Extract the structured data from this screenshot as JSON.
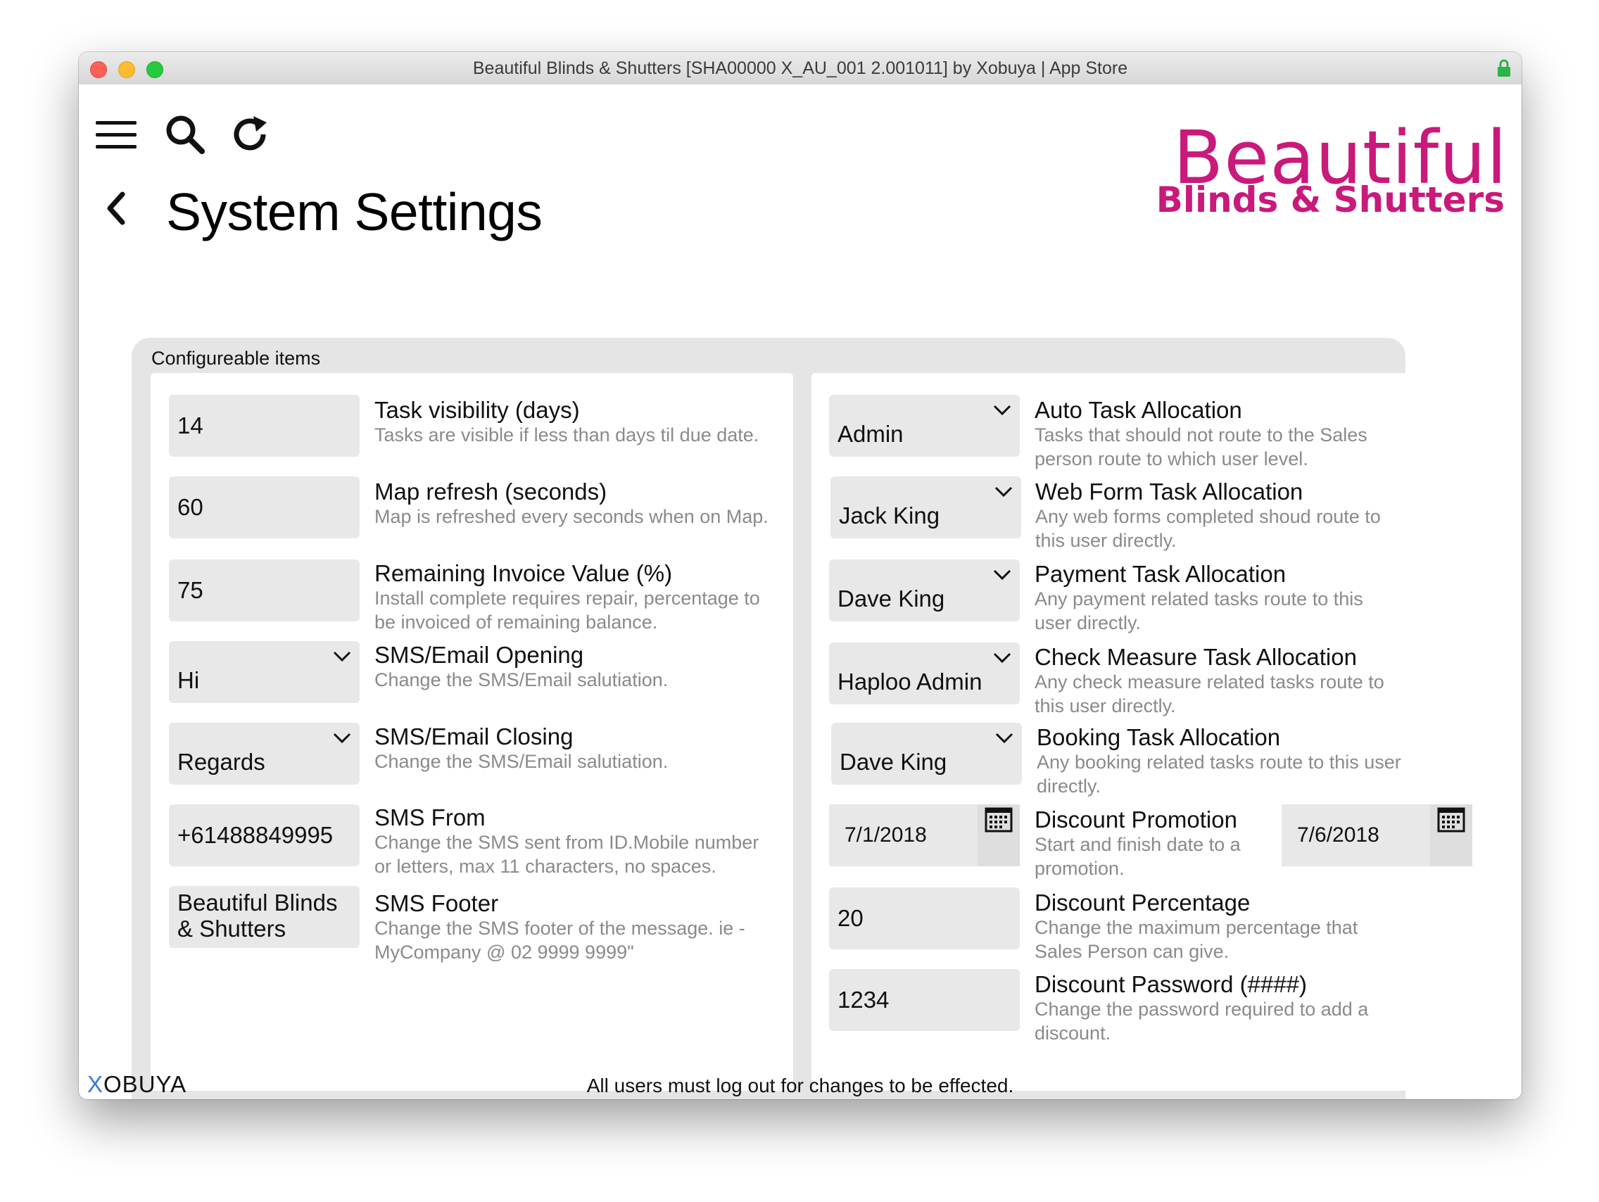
{
  "window": {
    "title": "Beautiful Blinds & Shutters [SHA00000 X_AU_001 2.001011] by Xobuya | App Store"
  },
  "toolbar": {
    "menu_icon": "hamburger-menu-icon",
    "search_icon": "search-icon",
    "refresh_icon": "refresh-icon"
  },
  "page": {
    "title": "System Settings",
    "back_icon": "chevron-left-icon"
  },
  "brand": {
    "line1": "Beautiful",
    "line2": "Blinds & Shutters",
    "color": "#c9197b"
  },
  "panel": {
    "label": "Configureable items"
  },
  "left_settings": [
    {
      "value": "14",
      "title": "Task visibility (days)",
      "desc": "Tasks are visible if less than days til due date."
    },
    {
      "value": "60",
      "title": "Map refresh (seconds)",
      "desc": "Map is refreshed every seconds when on Map."
    },
    {
      "value": "75",
      "title": "Remaining Invoice Value (%)",
      "desc": "Install complete requires repair, percentage to be invoiced of remaining balance."
    },
    {
      "value": "Hi",
      "title": "SMS/Email Opening",
      "desc": "Change the SMS/Email salutiation."
    },
    {
      "value": "Regards",
      "title": "SMS/Email Closing",
      "desc": "Change the SMS/Email salutiation."
    },
    {
      "value": "+61488849995",
      "title": "SMS From",
      "desc": "Change the SMS sent from ID.Mobile number or letters, max 11 characters, no spaces."
    },
    {
      "value": "Beautiful Blinds & Shutters",
      "title": "SMS Footer",
      "desc": "Change the SMS footer of the message. ie - MyCompany @ 02 9999 9999\""
    }
  ],
  "right_settings": [
    {
      "value": "Admin",
      "title": "Auto Task Allocation",
      "desc": "Tasks that should not route to the Sales person route to which user level."
    },
    {
      "value": "Jack King",
      "title": "Web Form Task Allocation",
      "desc": "Any web forms completed shoud route to this user directly."
    },
    {
      "value": "Dave King",
      "title": "Payment Task Allocation",
      "desc": "Any payment related tasks route to this user directly."
    },
    {
      "value": "Haploo Admin",
      "title": "Check Measure Task Allocation",
      "desc": "Any check measure related tasks route to this user directly."
    },
    {
      "value": "Dave King",
      "title": "Booking Task Allocation",
      "desc": "Any booking related tasks route to this user directly."
    },
    {
      "value": "7/1/2018",
      "value_end": "7/6/2018",
      "title": "Discount Promotion",
      "desc": "Start and finish date to a promotion."
    },
    {
      "value": "20",
      "title": "Discount Percentage",
      "desc": "Change the maximum percentage that Sales Person can give."
    },
    {
      "value": "1234",
      "title": "Discount Password (####)",
      "desc": "Change the password required to add a discount."
    }
  ],
  "footer": {
    "note": "All users must log out for changes to be effected.",
    "logo": "XOBUYA"
  }
}
